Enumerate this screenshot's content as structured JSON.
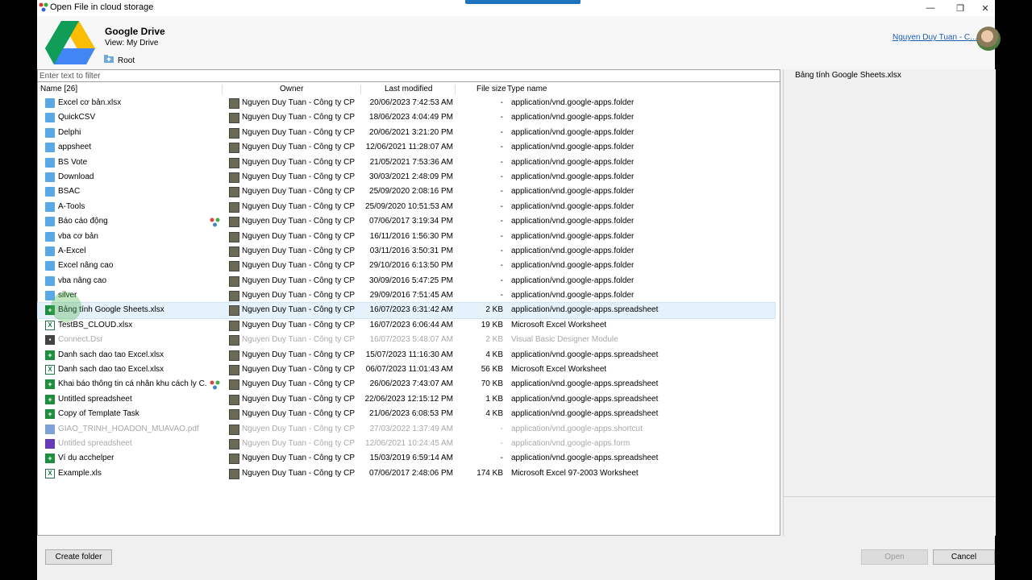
{
  "window": {
    "title": "Open File in cloud storage",
    "controls": {
      "minimize": "—",
      "maximize": "❐",
      "close": "✕"
    }
  },
  "header": {
    "service": "Google Drive",
    "view": "View: My Drive",
    "path_root": "Root",
    "account": "Nguyen Duy Tuan - C..."
  },
  "filter": {
    "placeholder": "Enter text to filter"
  },
  "columns": {
    "name": "Name [26]",
    "owner": "Owner",
    "modified": "Last modified",
    "size": "File size",
    "type": "Type name"
  },
  "files": [
    {
      "name": "Excel cơ bản.xlsx",
      "icon": "folder",
      "shared": false,
      "owner": "Nguyen Duy Tuan - Công ty CP ...",
      "modified": "20/06/2023 7:42:53 AM",
      "size": "-",
      "type": "application/vnd.google-apps.folder",
      "disabled": false,
      "selected": false
    },
    {
      "name": "QuickCSV",
      "icon": "folder",
      "shared": false,
      "owner": "Nguyen Duy Tuan - Công ty CP ...",
      "modified": "18/06/2023 4:04:49 PM",
      "size": "-",
      "type": "application/vnd.google-apps.folder",
      "disabled": false,
      "selected": false
    },
    {
      "name": "Delphi",
      "icon": "folder",
      "shared": false,
      "owner": "Nguyen Duy Tuan - Công ty CP ...",
      "modified": "20/06/2021 3:21:20 PM",
      "size": "-",
      "type": "application/vnd.google-apps.folder",
      "disabled": false,
      "selected": false
    },
    {
      "name": "appsheet",
      "icon": "folder",
      "shared": false,
      "owner": "Nguyen Duy Tuan - Công ty CP ...",
      "modified": "12/06/2021 11:28:07 AM",
      "size": "-",
      "type": "application/vnd.google-apps.folder",
      "disabled": false,
      "selected": false
    },
    {
      "name": "BS Vote",
      "icon": "folder",
      "shared": false,
      "owner": "Nguyen Duy Tuan - Công ty CP ...",
      "modified": "21/05/2021 7:53:36 AM",
      "size": "-",
      "type": "application/vnd.google-apps.folder",
      "disabled": false,
      "selected": false
    },
    {
      "name": "Download",
      "icon": "folder",
      "shared": false,
      "owner": "Nguyen Duy Tuan - Công ty CP ...",
      "modified": "30/03/2021 2:48:09 PM",
      "size": "-",
      "type": "application/vnd.google-apps.folder",
      "disabled": false,
      "selected": false
    },
    {
      "name": "BSAC",
      "icon": "folder",
      "shared": false,
      "owner": "Nguyen Duy Tuan - Công ty CP ...",
      "modified": "25/09/2020 2:08:16 PM",
      "size": "-",
      "type": "application/vnd.google-apps.folder",
      "disabled": false,
      "selected": false
    },
    {
      "name": "A-Tools",
      "icon": "folder",
      "shared": false,
      "owner": "Nguyen Duy Tuan - Công ty CP ...",
      "modified": "25/09/2020 10:51:53 AM",
      "size": "-",
      "type": "application/vnd.google-apps.folder",
      "disabled": false,
      "selected": false
    },
    {
      "name": "Báo cáo động",
      "icon": "folder",
      "shared": true,
      "owner": "Nguyen Duy Tuan - Công ty CP ...",
      "modified": "07/06/2017 3:19:34 PM",
      "size": "-",
      "type": "application/vnd.google-apps.folder",
      "disabled": false,
      "selected": false
    },
    {
      "name": "vba cơ bản",
      "icon": "folder",
      "shared": false,
      "owner": "Nguyen Duy Tuan - Công ty CP ...",
      "modified": "16/11/2016 1:56:30 PM",
      "size": "-",
      "type": "application/vnd.google-apps.folder",
      "disabled": false,
      "selected": false
    },
    {
      "name": "A-Excel",
      "icon": "folder",
      "shared": false,
      "owner": "Nguyen Duy Tuan - Công ty CP ...",
      "modified": "03/11/2016 3:50:31 PM",
      "size": "-",
      "type": "application/vnd.google-apps.folder",
      "disabled": false,
      "selected": false
    },
    {
      "name": "Excel nâng cao",
      "icon": "folder",
      "shared": false,
      "owner": "Nguyen Duy Tuan - Công ty CP ...",
      "modified": "29/10/2016 6:13:50 PM",
      "size": "-",
      "type": "application/vnd.google-apps.folder",
      "disabled": false,
      "selected": false
    },
    {
      "name": "vba nâng cao",
      "icon": "folder",
      "shared": false,
      "owner": "Nguyen Duy Tuan - Công ty CP ...",
      "modified": "30/09/2016 5:47:25 PM",
      "size": "-",
      "type": "application/vnd.google-apps.folder",
      "disabled": false,
      "selected": false
    },
    {
      "name": "silver",
      "icon": "folder",
      "shared": false,
      "owner": "Nguyen Duy Tuan - Công ty CP ...",
      "modified": "29/09/2016 7:51:45 AM",
      "size": "-",
      "type": "application/vnd.google-apps.folder",
      "disabled": false,
      "selected": false
    },
    {
      "name": "Bảng tính Google Sheets.xlsx",
      "icon": "sheet",
      "shared": false,
      "owner": "Nguyen Duy Tuan - Công ty CP ...",
      "modified": "16/07/2023 6:31:42 AM",
      "size": "2 KB",
      "type": "application/vnd.google-apps.spreadsheet",
      "disabled": false,
      "selected": true
    },
    {
      "name": "TestBS_CLOUD.xlsx",
      "icon": "excel",
      "shared": false,
      "owner": "Nguyen Duy Tuan - Công ty CP ...",
      "modified": "16/07/2023 6:06:44 AM",
      "size": "19 KB",
      "type": "Microsoft Excel Worksheet",
      "disabled": false,
      "selected": false
    },
    {
      "name": "Connect.Dsr",
      "icon": "dsr",
      "shared": false,
      "owner": "Nguyen Duy Tuan - Công ty CP ...",
      "modified": "16/07/2023 5:48:07 AM",
      "size": "2 KB",
      "type": "Visual Basic Designer Module",
      "disabled": true,
      "selected": false
    },
    {
      "name": "Danh sach dao tao Excel.xlsx",
      "icon": "sheet",
      "shared": false,
      "owner": "Nguyen Duy Tuan - Công ty CP ...",
      "modified": "15/07/2023 11:16:30 AM",
      "size": "4 KB",
      "type": "application/vnd.google-apps.spreadsheet",
      "disabled": false,
      "selected": false
    },
    {
      "name": "Danh sach dao tao Excel.xlsx",
      "icon": "excel",
      "shared": false,
      "owner": "Nguyen Duy Tuan - Công ty CP ...",
      "modified": "06/07/2023 11:01:43 AM",
      "size": "56 KB",
      "type": "Microsoft Excel Worksheet",
      "disabled": false,
      "selected": false
    },
    {
      "name": "Khai báo thông tin cá nhân khu cách ly C...",
      "icon": "sheet",
      "shared": true,
      "owner": "Nguyen Duy Tuan - Công ty CP ...",
      "modified": "26/06/2023 7:43:07 AM",
      "size": "70 KB",
      "type": "application/vnd.google-apps.spreadsheet",
      "disabled": false,
      "selected": false
    },
    {
      "name": "Untitled spreadsheet",
      "icon": "sheet",
      "shared": false,
      "owner": "Nguyen Duy Tuan - Công ty CP ...",
      "modified": "22/06/2023 12:15:12 PM",
      "size": "1 KB",
      "type": "application/vnd.google-apps.spreadsheet",
      "disabled": false,
      "selected": false
    },
    {
      "name": "Copy of Template Task",
      "icon": "sheet",
      "shared": false,
      "owner": "Nguyen Duy Tuan - Công ty CP ...",
      "modified": "21/06/2023 6:08:53 PM",
      "size": "4 KB",
      "type": "application/vnd.google-apps.spreadsheet",
      "disabled": false,
      "selected": false
    },
    {
      "name": "GIAO_TRINH_HOADON_MUAVAO.pdf",
      "icon": "pdf",
      "shared": false,
      "owner": "Nguyen Duy Tuan - Công ty CP ...",
      "modified": "27/03/2022 1:37:49 AM",
      "size": "-",
      "type": "application/vnd.google-apps.shortcut",
      "disabled": true,
      "selected": false
    },
    {
      "name": "Untitled spreadsheet",
      "icon": "form",
      "shared": false,
      "owner": "Nguyen Duy Tuan - Công ty CP ...",
      "modified": "12/06/2021 10:24:45 AM",
      "size": "-",
      "type": "application/vnd.google-apps.form",
      "disabled": true,
      "selected": false
    },
    {
      "name": "Ví dụ acchelper",
      "icon": "sheet",
      "shared": false,
      "owner": "Nguyen Duy Tuan - Công ty CP ...",
      "modified": "15/03/2019 6:59:14 AM",
      "size": "-",
      "type": "application/vnd.google-apps.spreadsheet",
      "disabled": false,
      "selected": false
    },
    {
      "name": "Example.xls",
      "icon": "excel",
      "shared": false,
      "owner": "Nguyen Duy Tuan - Công ty CP ...",
      "modified": "07/06/2017 2:48:06 PM",
      "size": "174 KB",
      "type": "Microsoft Excel 97-2003 Worksheet",
      "disabled": false,
      "selected": false
    }
  ],
  "side_panel": {
    "selected_name": "Bảng tính Google Sheets.xlsx"
  },
  "buttons": {
    "create_folder": "Create folder",
    "open": "Open",
    "cancel": "Cancel"
  },
  "colors": {
    "accent": "#1e73be",
    "selection": "#e5f1fb",
    "folder": "#5aa9e6",
    "sheets": "#1e8e3e"
  }
}
